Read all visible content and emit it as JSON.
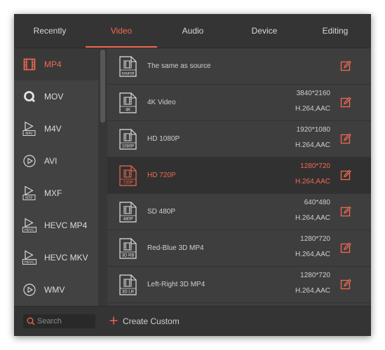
{
  "colors": {
    "accent": "#ef6a4f",
    "panel_bg": "#3c3b3b",
    "sidebar_bg": "#434242",
    "text": "#d8d8d8"
  },
  "tabs": [
    {
      "label": "Recently"
    },
    {
      "label": "Video",
      "active": true
    },
    {
      "label": "Audio"
    },
    {
      "label": "Device"
    },
    {
      "label": "Editing"
    }
  ],
  "sidebar": {
    "items": [
      {
        "label": "MP4",
        "icon": "film-strip-icon",
        "active": true
      },
      {
        "label": "MOV",
        "icon": "quicktime-icon"
      },
      {
        "label": "M4V",
        "icon": "m4v-play-icon",
        "badge": "M4V"
      },
      {
        "label": "AVI",
        "icon": "play-circle-icon"
      },
      {
        "label": "MXF",
        "icon": "mxf-play-icon",
        "badge": "MXF"
      },
      {
        "label": "HEVC MP4",
        "icon": "hevc-play-icon",
        "badge": "HEVC"
      },
      {
        "label": "HEVC MKV",
        "icon": "hevc-play-icon",
        "badge": "HEVC"
      },
      {
        "label": "WMV",
        "icon": "play-circle-icon"
      }
    ]
  },
  "formats": [
    {
      "name": "The same as source",
      "icon_label": "source",
      "resolution": "",
      "codec": ""
    },
    {
      "name": "4K Video",
      "icon_label": "4K",
      "resolution": "3840*2160",
      "codec": "H.264,AAC"
    },
    {
      "name": "HD 1080P",
      "icon_label": "1080P",
      "resolution": "1920*1080",
      "codec": "H.264,AAC"
    },
    {
      "name": "HD 720P",
      "icon_label": "720P",
      "resolution": "1280*720",
      "codec": "H.264,AAC",
      "active": true
    },
    {
      "name": "SD 480P",
      "icon_label": "480P",
      "resolution": "640*480",
      "codec": "H.264,AAC"
    },
    {
      "name": "Red-Blue 3D MP4",
      "icon_label": "3D RB",
      "resolution": "1280*720",
      "codec": "H.264,AAC"
    },
    {
      "name": "Left-Right 3D MP4",
      "icon_label": "3D LR",
      "resolution": "1280*720",
      "codec": "H.264,AAC"
    }
  ],
  "search": {
    "placeholder": "Search",
    "value": ""
  },
  "create_custom": {
    "label": "Create Custom"
  }
}
